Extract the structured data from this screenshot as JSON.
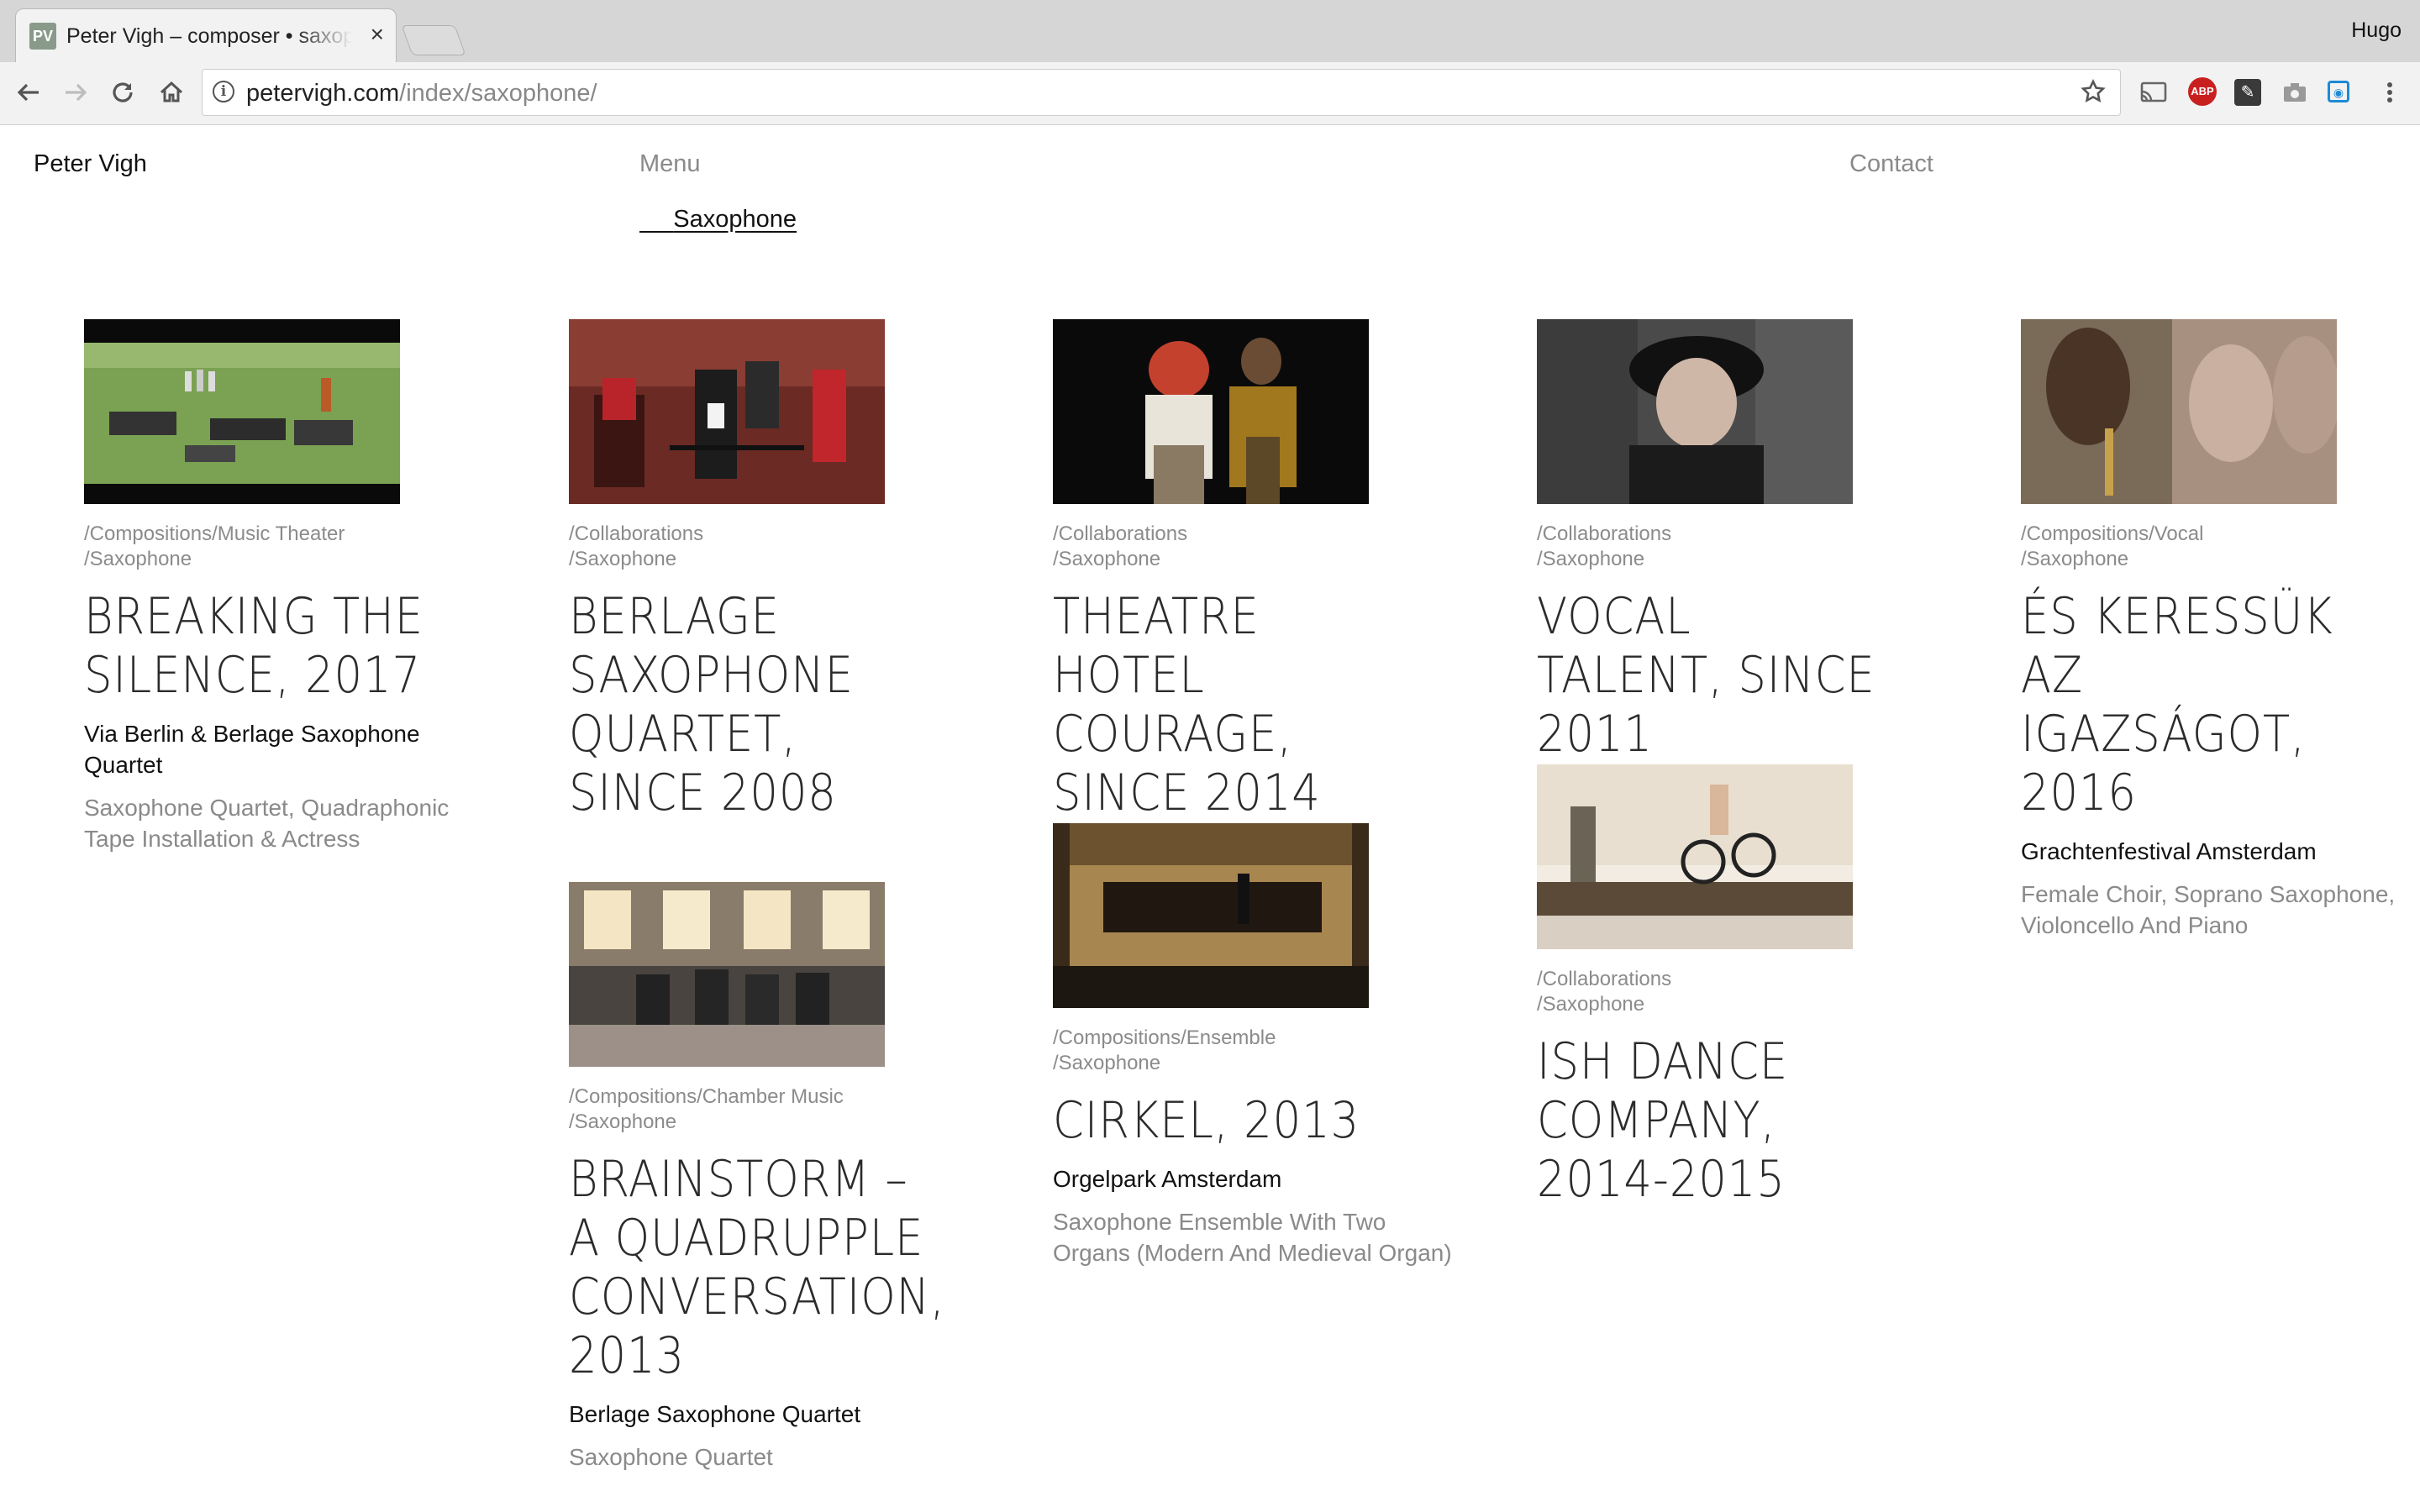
{
  "browser": {
    "tab_title": "Peter Vigh – composer • saxophone",
    "favicon_text": "PV",
    "close_glyph": "×",
    "profile_name": "Hugo",
    "url_host": "petervigh.com",
    "url_path": "/index/saxophone/",
    "icons": {
      "back": "back-arrow-icon",
      "forward": "forward-arrow-icon",
      "reload": "reload-icon",
      "home": "home-icon",
      "info": "info-icon",
      "star": "star-icon",
      "cast": "cast-icon",
      "adblock": "adblock-icon",
      "ext": "extension-icon",
      "camera": "camera-icon",
      "screenshot": "screenshot-icon",
      "menu": "menu-dots-icon"
    },
    "adblock_text": "ABP"
  },
  "header": {
    "site_title": "Peter Vigh",
    "menu": "Menu",
    "contact": "Contact",
    "breadcrumb": "Saxophone"
  },
  "projects": [
    {
      "cat1": "/Compositions/Music Theater",
      "cat2": "/Saxophone",
      "title": "Breaking the Silence, 2017",
      "venue": "Via Berlin & Berlage Saxophone Quartet",
      "description": "Saxophone Quartet, Quadraphonic Tape Installation & Actress"
    },
    {
      "cat1": "/Collaborations",
      "cat2": "/Saxophone",
      "title": "Berlage Saxophone Quartet, since 2008"
    },
    {
      "cat1": "/Compositions/Chamber Music",
      "cat2": "/Saxophone",
      "title": "Brainstorm – a quadrupple conversation, 2013",
      "venue": "Berlage Saxophone Quartet",
      "description": "Saxophone Quartet"
    },
    {
      "cat1": "/Collaborations",
      "cat2": "/Saxophone",
      "title": "Theatre Hotel Courage, since 2014"
    },
    {
      "cat1": "/Compositions/Ensemble",
      "cat2": "/Saxophone",
      "title": "Cirkel, 2013",
      "venue": "Orgelpark Amsterdam",
      "description": "Saxophone Ensemble With Two Organs (Modern And Medieval Organ)"
    },
    {
      "cat1": "/Collaborations",
      "cat2": "/Saxophone",
      "title": "Vocal Talent, since 2011"
    },
    {
      "cat1": "/Collaborations",
      "cat2": "/Saxophone",
      "title": "ISH Dance Company, 2014-2015"
    },
    {
      "cat1": "/Compositions/Vocal",
      "cat2": "/Saxophone",
      "title": "És keressük az igazságot, 2016",
      "venue": "Grachtenfestival Amsterdam",
      "description": "Female Choir, Soprano Saxophone, Violoncello And Piano"
    }
  ]
}
